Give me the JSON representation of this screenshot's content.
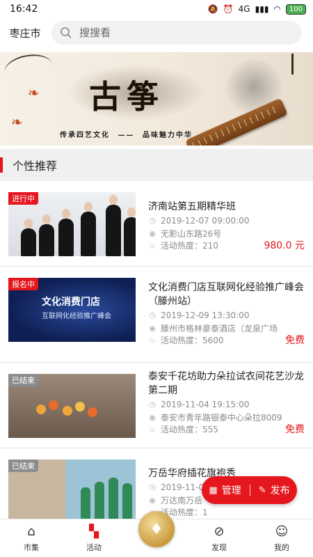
{
  "status_bar": {
    "time": "16:42",
    "battery": "100",
    "network": "4G"
  },
  "header": {
    "city": "枣庄市",
    "search_placeholder": "搜搜看"
  },
  "banner": {
    "title": "古筝",
    "slogan_left": "传承四艺文化",
    "slogan_right": "品味魅力中华"
  },
  "section": {
    "title": "个性推荐"
  },
  "events": [
    {
      "status": "进行中",
      "status_type": "live",
      "title": "济南站第五期精华班",
      "date": "2019-12-07 09:00:00",
      "address": "无影山东路26号",
      "heat": "活动热度：210",
      "price": "980.0 元"
    },
    {
      "status": "报名中",
      "status_type": "signup",
      "title": "文化消费门店互联网化经验推广峰会（滕州站）",
      "date": "2019-12-09 13:30:00",
      "address": "滕州市格林豪泰酒店（龙泉广场",
      "heat": "活动热度：5600",
      "price": "免费",
      "thumb_title": "文化消费门店",
      "thumb_sub": "互联网化经验推广峰会"
    },
    {
      "status": "已结束",
      "status_type": "ended",
      "title": "泰安千花坊助力朵拉试衣间花艺沙龙第二期",
      "date": "2019-11-04 19:15:00",
      "address": "泰安市青年路银泰中心朵拉8009",
      "heat": "活动热度：555",
      "price": "免费"
    },
    {
      "status": "已结束",
      "status_type": "ended",
      "title": "万岳华府插花旗袍秀",
      "date": "2019-11-07 1",
      "address": "万达南万岳",
      "heat": "活动热度：1",
      "price": ""
    }
  ],
  "fab": {
    "manage": "管理",
    "publish": "发布"
  },
  "nav": [
    {
      "label": "市集",
      "icon": "home-icon"
    },
    {
      "label": "活动",
      "icon": "activity-icon"
    },
    {
      "label": "",
      "icon": "diamond-icon"
    },
    {
      "label": "发现",
      "icon": "compass-icon"
    },
    {
      "label": "我的",
      "icon": "user-icon"
    }
  ]
}
